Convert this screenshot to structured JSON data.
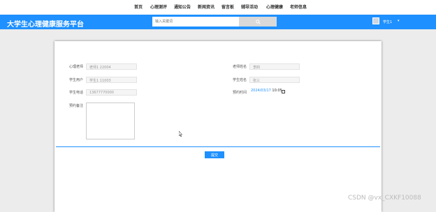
{
  "nav": {
    "items": [
      "首页",
      "心理测评",
      "通知公告",
      "新闻资讯",
      "留言板",
      "辅导活动",
      "心理健康",
      "老师信息"
    ]
  },
  "header": {
    "brand": "大学生心理健康服务平台",
    "search_placeholder": "输入关键词",
    "search_icon": "search-icon",
    "user_name": "学生1",
    "caret": "▾"
  },
  "form": {
    "teacher_id_label": "心理老师",
    "teacher_id_value": "老师1 22004",
    "student_id_label": "学生用户",
    "student_id_value": "学生1 11003",
    "phone_label": "学生电话",
    "phone_value": "13677770000",
    "remark_label": "预约备注",
    "teacher_name_label": "老师姓名",
    "teacher_name_value": "李四",
    "student_name_label": "学生姓名",
    "student_name_value": "张三",
    "time_label": "预约时间",
    "time_date": "2024/03/17",
    "time_clock": "10:05",
    "submit_label": "提交"
  },
  "watermark": "CSDN @vx_CXKF10088",
  "colors": {
    "accent": "#1e90ff"
  }
}
